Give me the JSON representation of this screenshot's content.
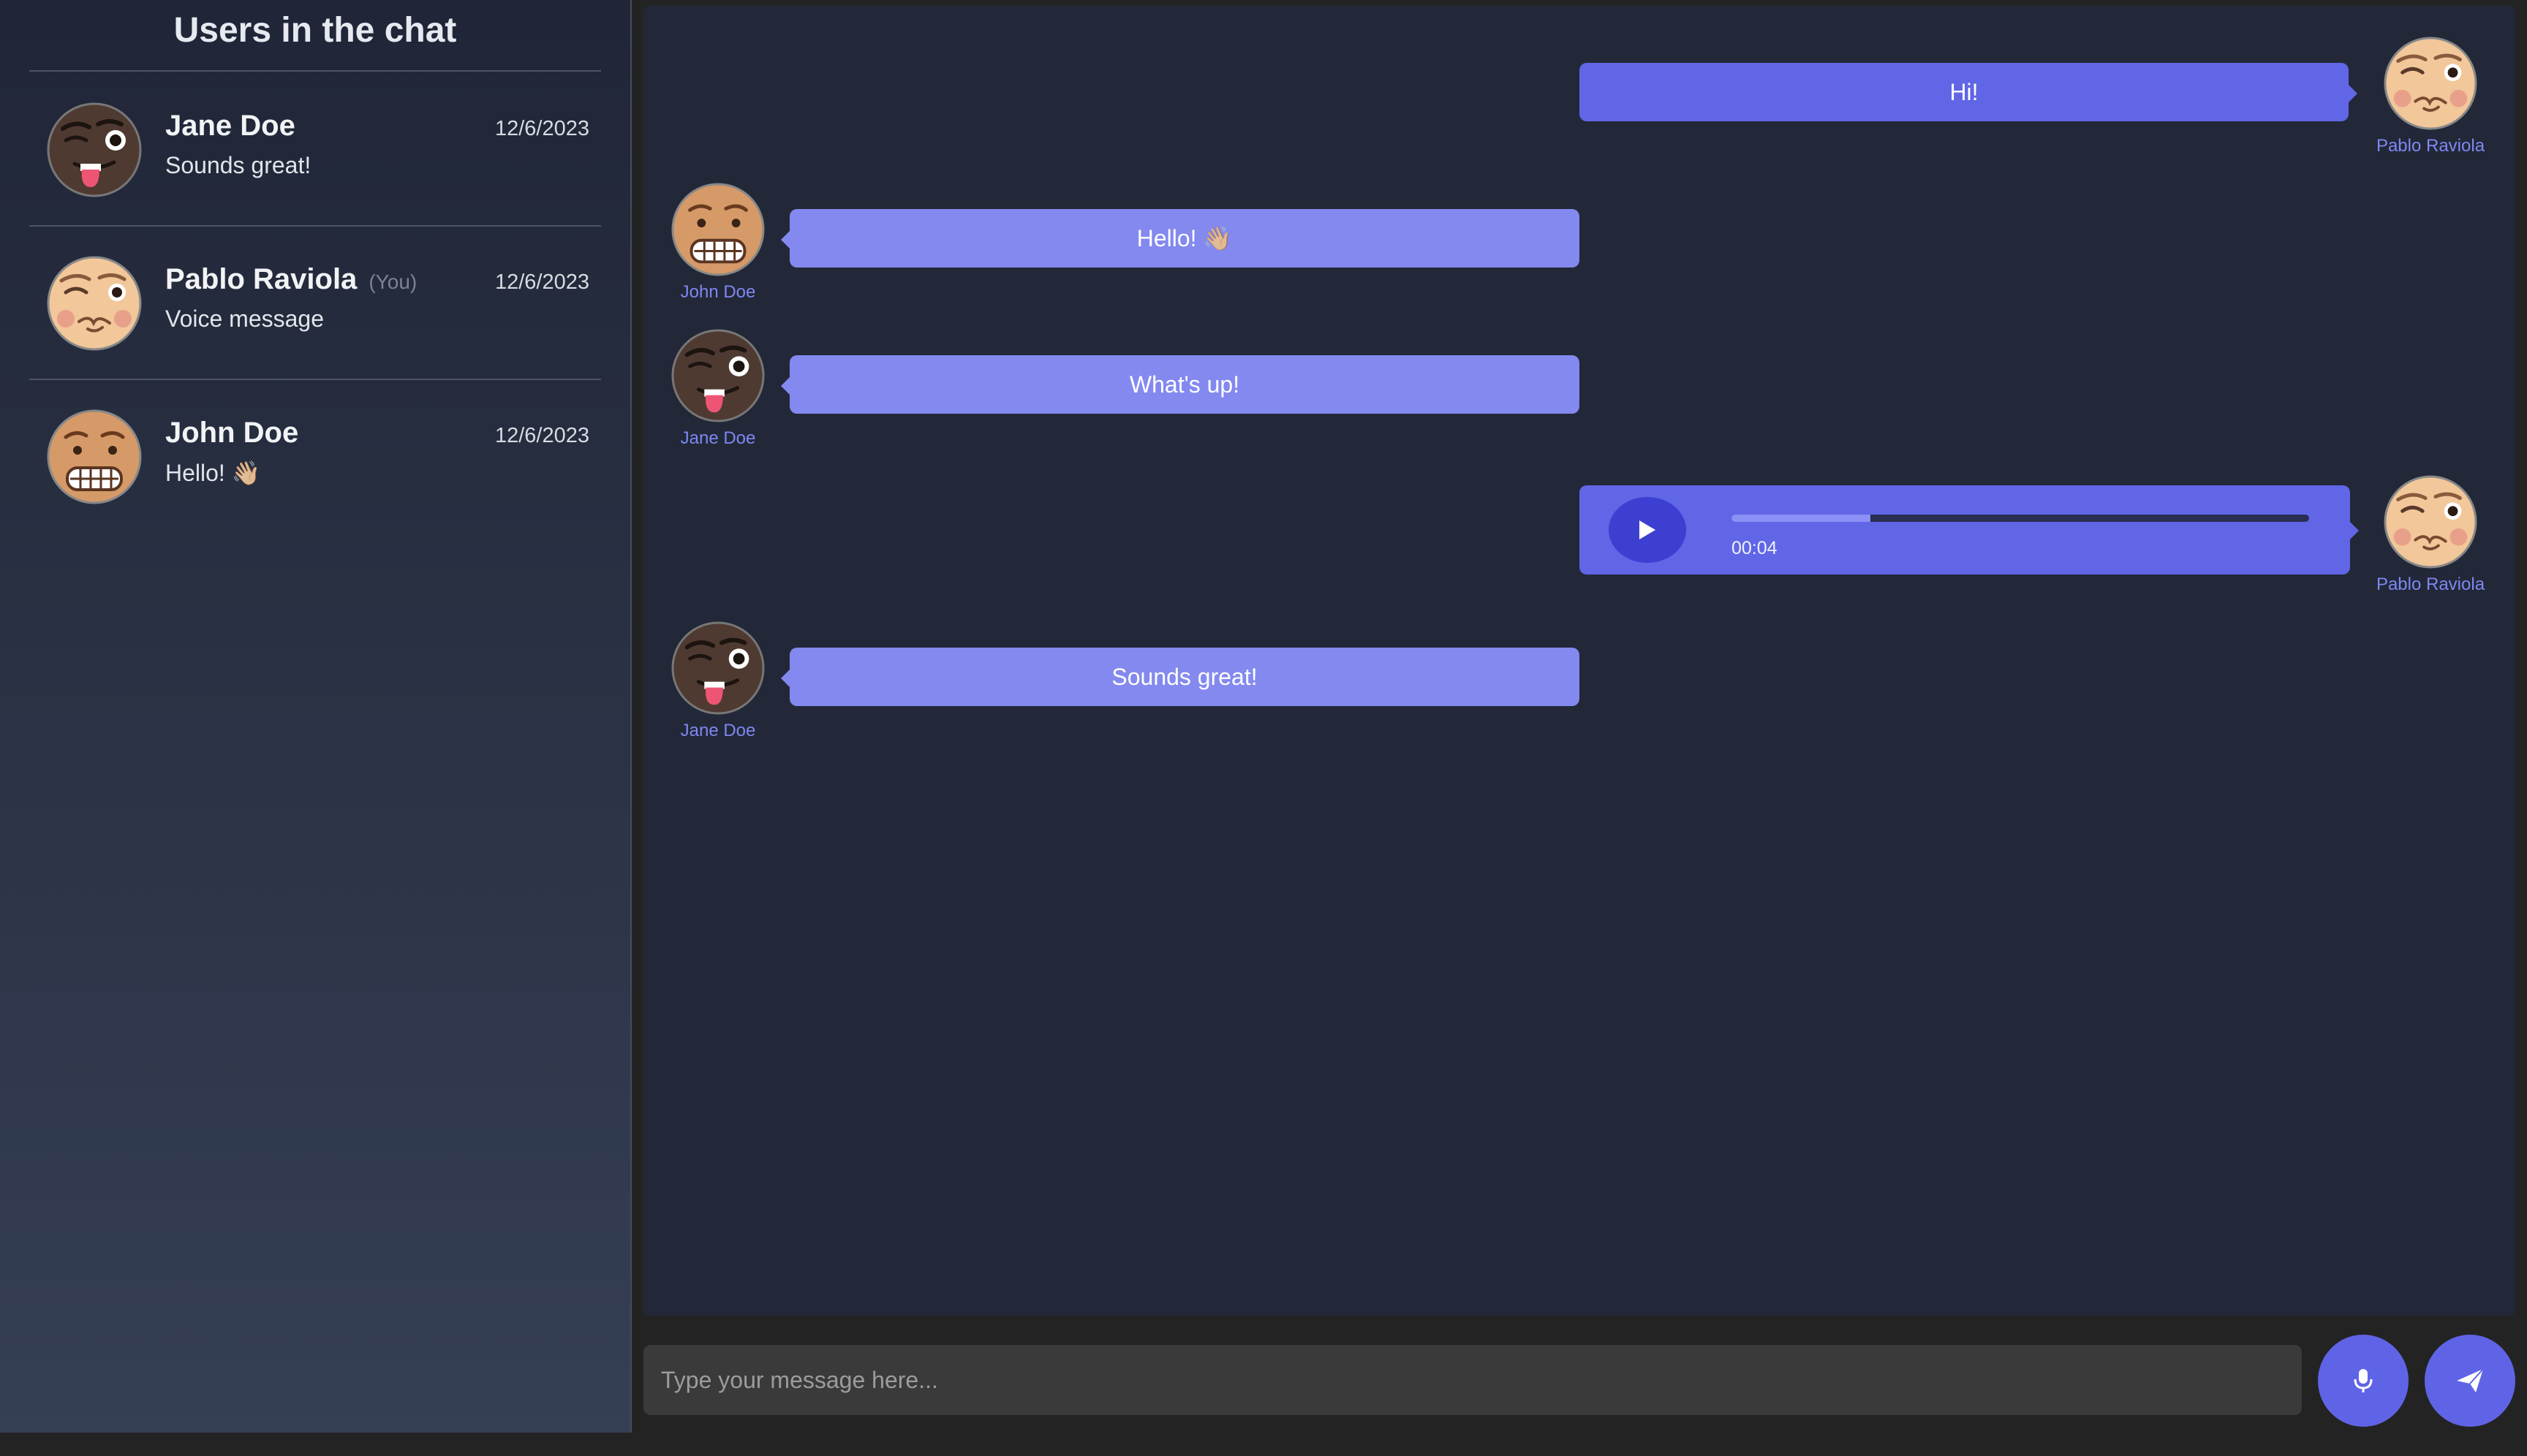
{
  "sidebar": {
    "title": "Users in the chat",
    "users": [
      {
        "name": "Jane Doe",
        "you": "",
        "preview": "Sounds great!",
        "date": "12/6/2023",
        "avatar": "dark-wink-tongue-face"
      },
      {
        "name": "Pablo Raviola",
        "you": "(You)",
        "preview": "Voice message",
        "date": "12/6/2023",
        "avatar": "peach-wink-smirk-face"
      },
      {
        "name": "John Doe",
        "you": "",
        "preview": "Hello! 👋🏼",
        "date": "12/6/2023",
        "avatar": "tan-grimace-face"
      }
    ]
  },
  "messages": [
    {
      "author": "Pablo Raviola",
      "text": "Hi!",
      "own": true
    },
    {
      "author": "John Doe",
      "text": "Hello! 👋🏼",
      "own": false
    },
    {
      "author": "Jane Doe",
      "text": "What's up!",
      "own": false
    },
    {
      "author": "Pablo Raviola",
      "type": "voice",
      "duration": "00:04",
      "progress_percent": 24,
      "own": true
    },
    {
      "author": "Jane Doe",
      "text": "Sounds great!",
      "own": false
    }
  ],
  "composer": {
    "placeholder": "Type your message here...",
    "mic_icon": "microphone-icon",
    "send_icon": "paper-plane-icon"
  },
  "colors": {
    "accent": "#6066e6",
    "incoming_bubble": "#8389ef",
    "author_label": "#7f87f3",
    "background": "#222837"
  }
}
